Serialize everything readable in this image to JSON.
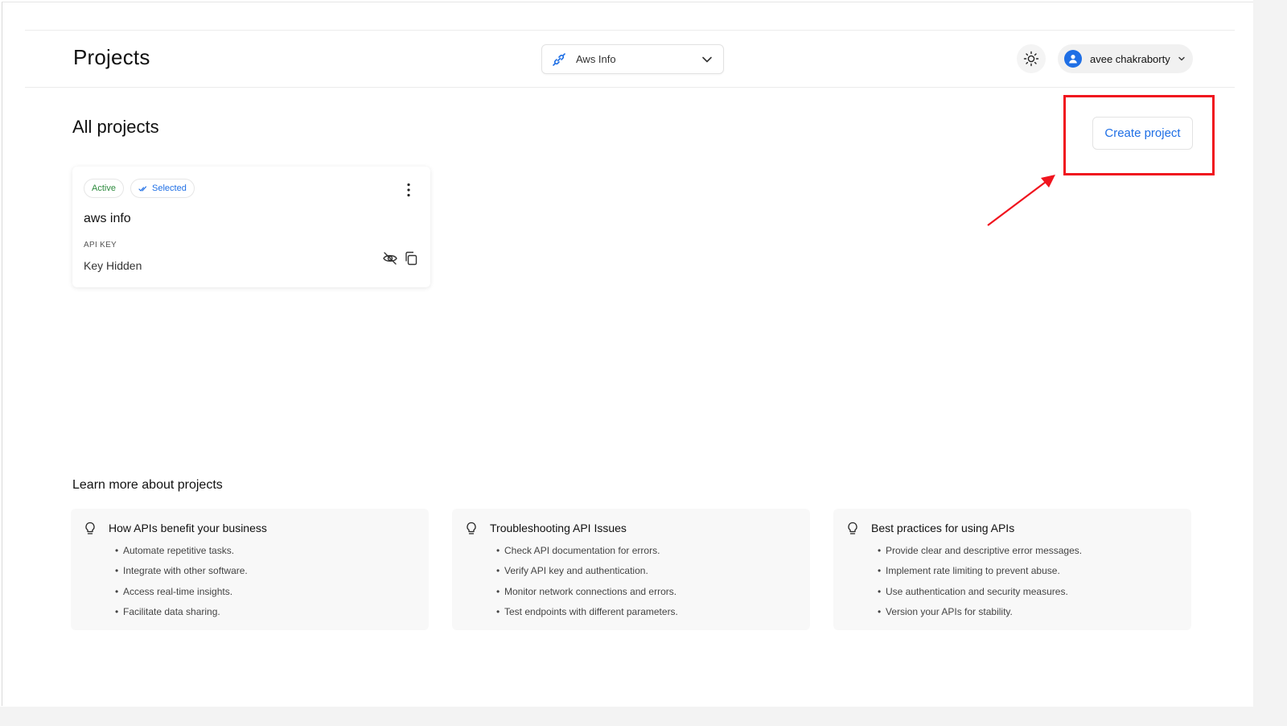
{
  "header": {
    "page_title": "Projects",
    "project_select": {
      "value": "Aws Info",
      "icon": "link-icon"
    },
    "theme_toggle": {
      "icon": "sun-icon"
    },
    "user": {
      "name": "avee chakraborty",
      "icon": "user-avatar-icon"
    }
  },
  "main": {
    "section_title": "All projects",
    "create_button": "Create project",
    "projects": [
      {
        "status": "Active",
        "selected_label": "Selected",
        "name": "aws info",
        "api_key_label": "API KEY",
        "api_key_value": "Key Hidden"
      }
    ]
  },
  "learn": {
    "title": "Learn more about projects",
    "cards": [
      {
        "title": "How APIs benefit your business",
        "items": [
          "Automate repetitive tasks.",
          "Integrate with other software.",
          "Access real-time insights.",
          "Facilitate data sharing."
        ]
      },
      {
        "title": "Troubleshooting API Issues",
        "items": [
          "Check API documentation for errors.",
          "Verify API key and authentication.",
          "Monitor network connections and errors.",
          "Test endpoints with different parameters."
        ]
      },
      {
        "title": "Best practices for using APIs",
        "items": [
          "Provide clear and descriptive error messages.",
          "Implement rate limiting to prevent abuse.",
          "Use authentication and security measures.",
          "Version your APIs for stability."
        ]
      }
    ]
  },
  "colors": {
    "accent": "#1f6fe5",
    "active_green": "#2e8b3e",
    "annotation_red": "#f0141e"
  }
}
